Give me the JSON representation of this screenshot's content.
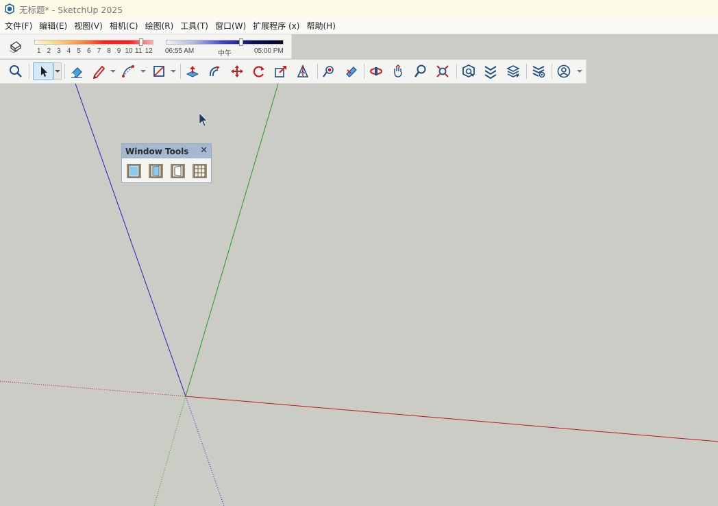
{
  "window": {
    "title": "无标题* - SketchUp 2025"
  },
  "menu": {
    "items": [
      "文件(F)",
      "编辑(E)",
      "视图(V)",
      "相机(C)",
      "绘图(R)",
      "工具(T)",
      "窗口(W)",
      "扩展程序 (x)",
      "帮助(H)"
    ]
  },
  "shadows": {
    "months": [
      "1",
      "2",
      "3",
      "4",
      "5",
      "6",
      "7",
      "8",
      "9",
      "10",
      "11",
      "12"
    ],
    "month_value": 11,
    "time_start": "06:55 AM",
    "time_noon": "中午",
    "time_end": "05:00 PM",
    "time_value_fraction": 0.64
  },
  "toolbar": {
    "icons": [
      "search-icon",
      "select-icon",
      "eraser-icon",
      "pencil-icon",
      "arc-icon",
      "rectangle-icon",
      "push-pull-icon",
      "offset-icon",
      "move-icon",
      "rotate-icon",
      "scale-icon",
      "tape-measure-icon",
      "paint-bucket-icon",
      "orbit-icon",
      "pan-icon",
      "zoom-icon",
      "zoom-extents-icon",
      "warehouse-icon",
      "extension-warehouse-icon",
      "layer-icon",
      "extension-manager-icon",
      "profile-icon"
    ]
  },
  "palette": {
    "title": "Window Tools",
    "buttons": [
      "window-tool-1",
      "window-tool-2",
      "window-tool-3",
      "window-tool-4"
    ]
  },
  "colors": {
    "axis_red": "#c01818",
    "axis_green": "#1ea11e",
    "axis_blue": "#2222c0",
    "viewport_bg": "#cbccc6"
  }
}
